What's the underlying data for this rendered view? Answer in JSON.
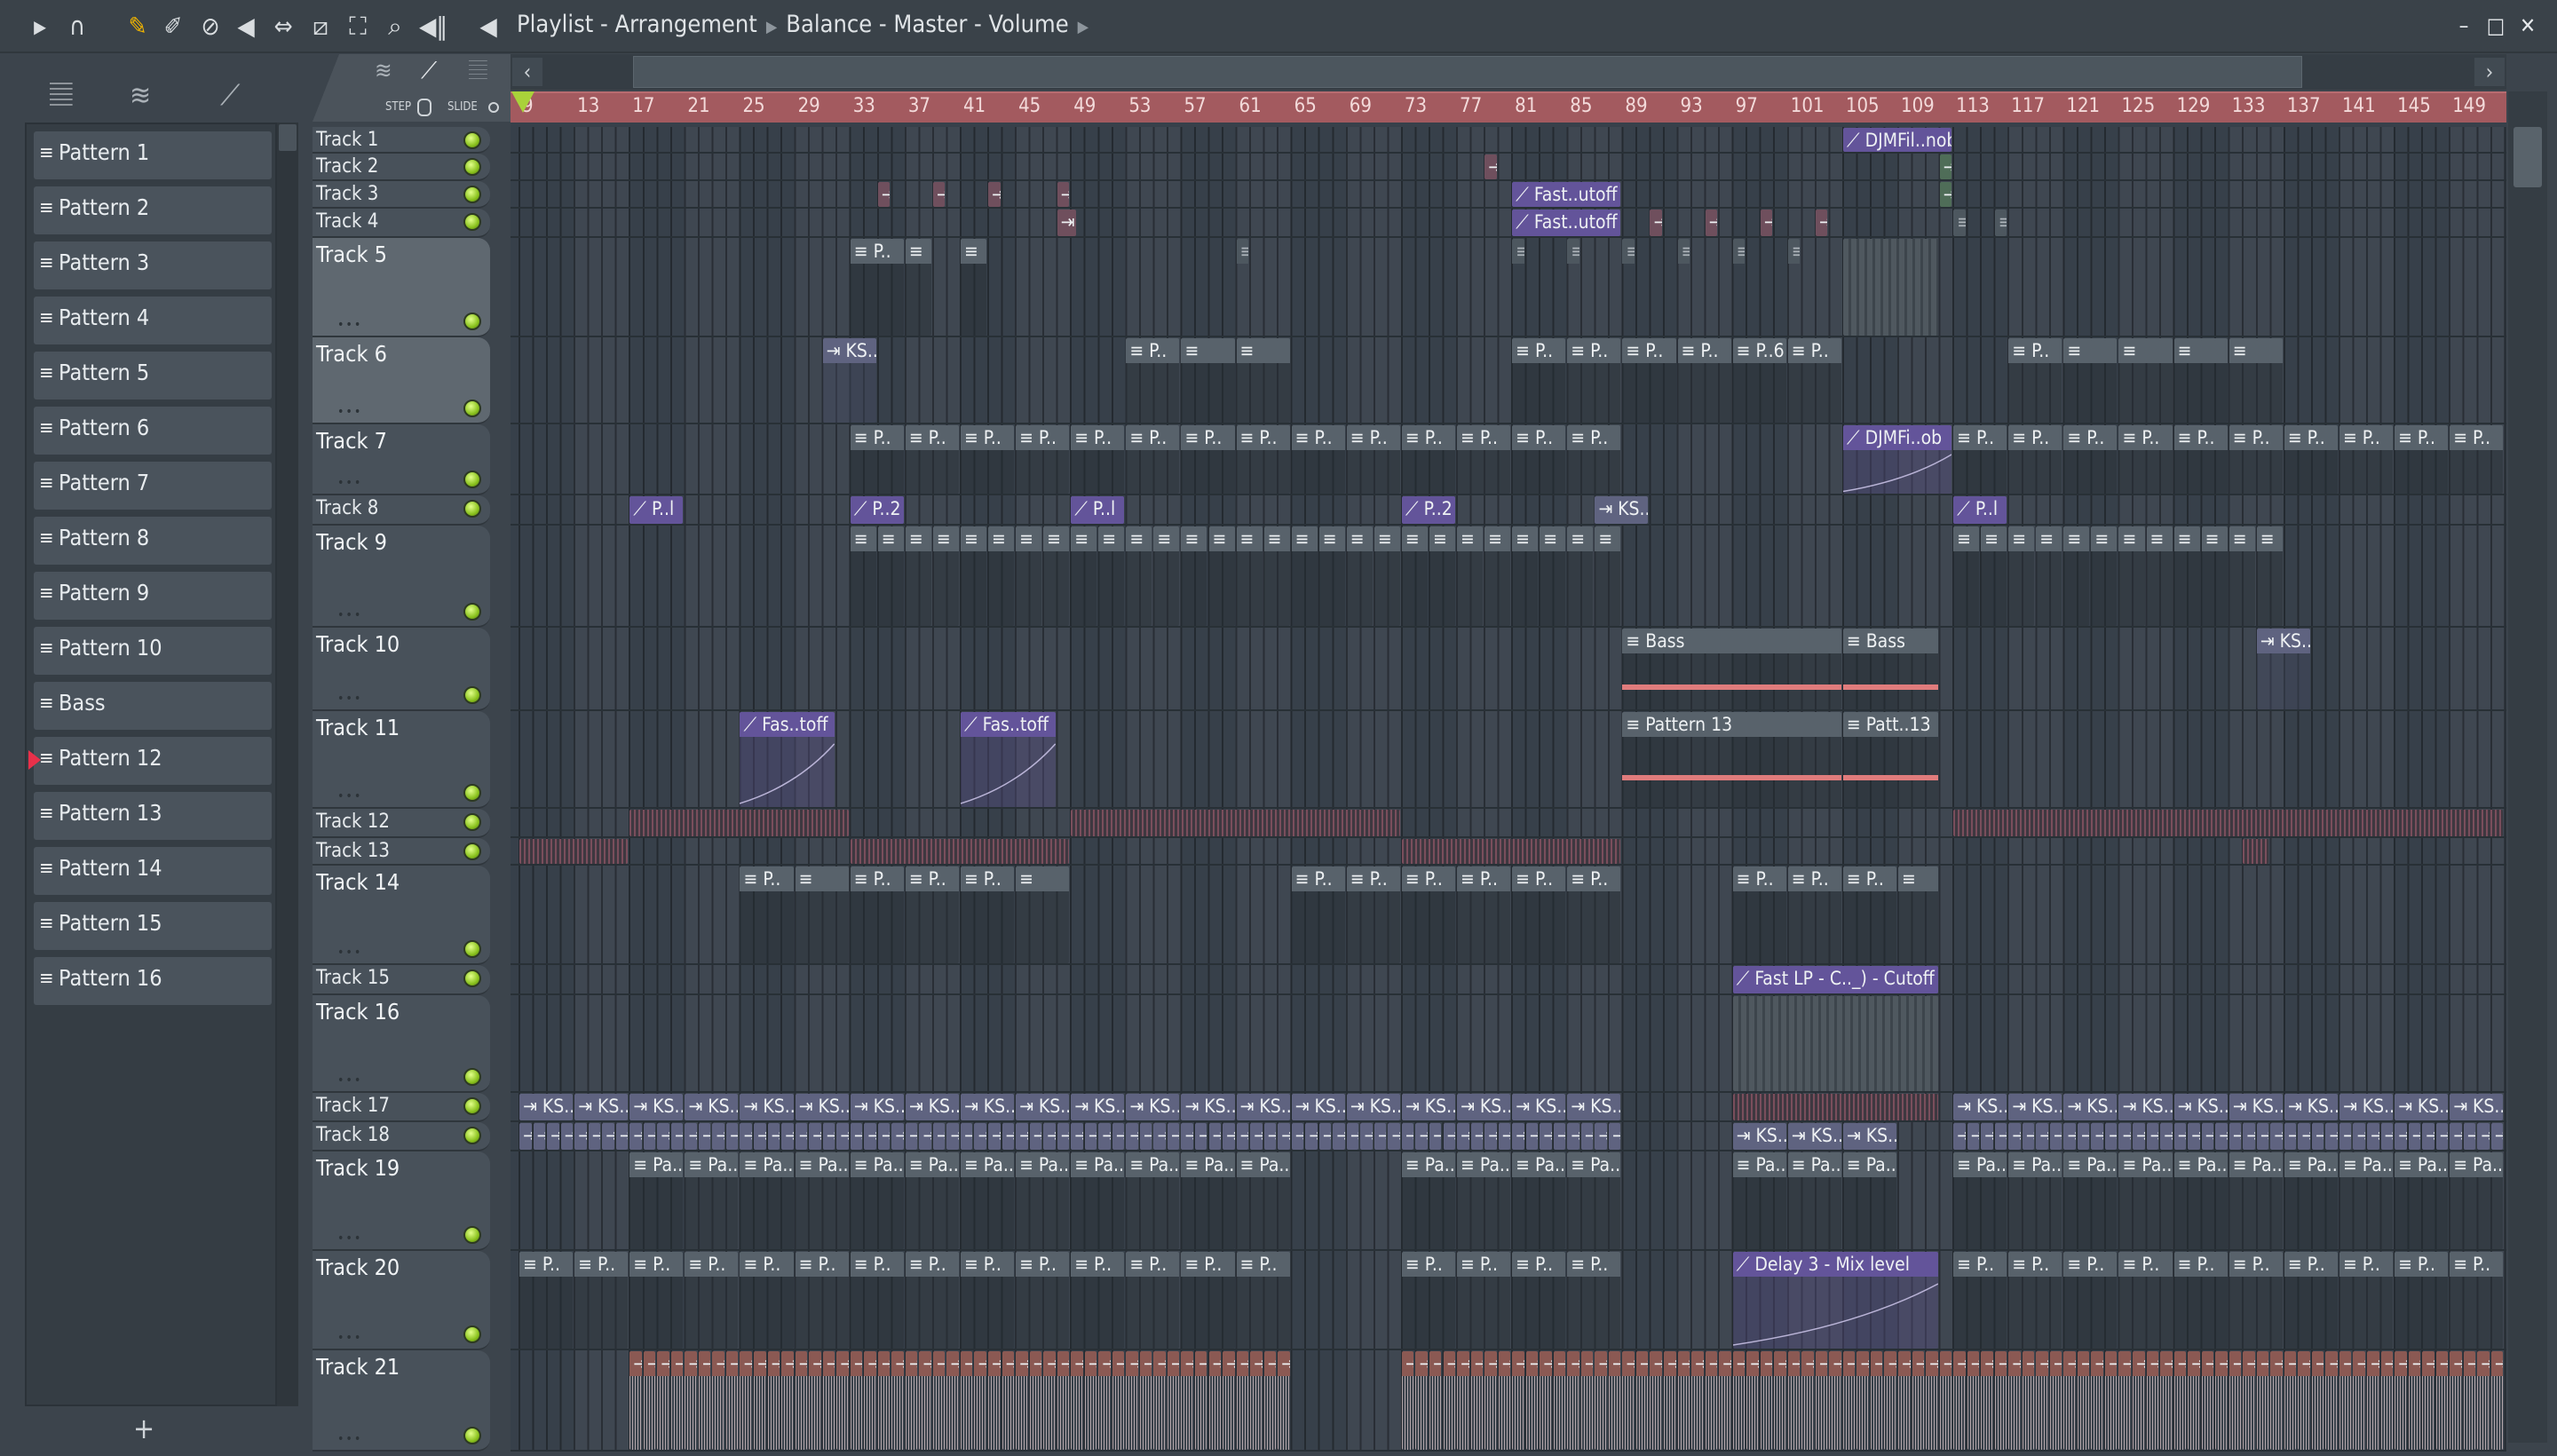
{
  "toolbar": {
    "icons": [
      "play-arrow",
      "magnet",
      "pencil",
      "paint",
      "delete",
      "mute",
      "slip",
      "slice",
      "select",
      "zoom",
      "playback"
    ],
    "title": "Playlist - Arrangement",
    "breadcrumb": "Balance - Master - Volume"
  },
  "window_controls": {
    "minimize": "–",
    "maximize": "□",
    "close": "✕"
  },
  "tool_tab": {
    "step_label": "STEP",
    "slide_label": "SLIDE"
  },
  "accent": {
    "ruler": "#a35a5f",
    "playhead": "#a9d23a",
    "led": "#8ac21e",
    "selected_marker": "#e8304a"
  },
  "patterns": [
    {
      "label": "Pattern 1"
    },
    {
      "label": "Pattern 2"
    },
    {
      "label": "Pattern 3"
    },
    {
      "label": "Pattern 4"
    },
    {
      "label": "Pattern 5"
    },
    {
      "label": "Pattern 6"
    },
    {
      "label": "Pattern 7"
    },
    {
      "label": "Pattern 8"
    },
    {
      "label": "Pattern 9"
    },
    {
      "label": "Pattern 10"
    },
    {
      "label": "Bass"
    },
    {
      "label": "Pattern 12",
      "selected": true
    },
    {
      "label": "Pattern 13"
    },
    {
      "label": "Pattern 14"
    },
    {
      "label": "Pattern 15"
    },
    {
      "label": "Pattern 16"
    }
  ],
  "add_pattern": "+",
  "ruler": {
    "bars": [
      9,
      13,
      17,
      21,
      25,
      29,
      33,
      37,
      41,
      45,
      49,
      53,
      57,
      61,
      65,
      69,
      73,
      77,
      81,
      85,
      89,
      93,
      97,
      101,
      105,
      109,
      113,
      117,
      121,
      125,
      129,
      133,
      137,
      141,
      145,
      149
    ]
  },
  "tracks": [
    {
      "label": "Track 1"
    },
    {
      "label": "Track 2"
    },
    {
      "label": "Track 3"
    },
    {
      "label": "Track 4"
    },
    {
      "label": "Track 5",
      "tall": true,
      "highlight": true
    },
    {
      "label": "Track 6",
      "tall": true,
      "highlight": true
    },
    {
      "label": "Track 7",
      "tall": true
    },
    {
      "label": "Track 8"
    },
    {
      "label": "Track 9",
      "tall": true
    },
    {
      "label": "Track 10",
      "tall": true
    },
    {
      "label": "Track 11",
      "tall": true
    },
    {
      "label": "Track 12"
    },
    {
      "label": "Track 13"
    },
    {
      "label": "Track 14",
      "tall": true
    },
    {
      "label": "Track 15"
    },
    {
      "label": "Track 16",
      "tall": true
    },
    {
      "label": "Track 17"
    },
    {
      "label": "Track 18"
    },
    {
      "label": "Track 19",
      "tall": true
    },
    {
      "label": "Track 20",
      "tall": true
    },
    {
      "label": "Track 21",
      "tall": true
    }
  ],
  "clips": [
    {
      "t": 1,
      "s": 105,
      "l": 8,
      "type": "auto",
      "label": "DJMFil..nob"
    },
    {
      "t": 2,
      "s": 79,
      "l": 1,
      "type": "audio-red",
      "label": ""
    },
    {
      "t": 2,
      "s": 112,
      "l": 1,
      "type": "audio-green",
      "label": ""
    },
    {
      "t": 3,
      "s": 35,
      "l": 1,
      "n": 3,
      "step": 4,
      "type": "audio-red",
      "label": ""
    },
    {
      "t": 3,
      "s": 48,
      "l": 1,
      "type": "audio-red",
      "label": ""
    },
    {
      "t": 3,
      "s": 81,
      "l": 8,
      "type": "auto",
      "label": "Fast..utoff"
    },
    {
      "t": 3,
      "s": 112,
      "l": 1,
      "type": "audio-green",
      "label": ""
    },
    {
      "t": 4,
      "s": 48,
      "l": 1.5,
      "type": "audio-red",
      "label": ""
    },
    {
      "t": 4,
      "s": 81,
      "l": 8,
      "type": "auto",
      "label": "Fast..utoff"
    },
    {
      "t": 4,
      "s": 91,
      "l": 1,
      "n": 4,
      "step": 4,
      "type": "audio-red",
      "label": ""
    },
    {
      "t": 4,
      "s": 113,
      "l": 1,
      "n": 2,
      "step": 3,
      "type": "mini",
      "label": ""
    },
    {
      "t": 5,
      "s": 33,
      "l": 4,
      "type": "pattern",
      "label": "P.."
    },
    {
      "t": 5,
      "s": 37,
      "l": 2,
      "type": "pattern",
      "label": ""
    },
    {
      "t": 5,
      "s": 41,
      "l": 2,
      "type": "pattern",
      "label": ""
    },
    {
      "t": 5,
      "s": 61,
      "l": 1,
      "type": "mini",
      "label": ""
    },
    {
      "t": 5,
      "s": 81,
      "l": 1,
      "n": 6,
      "step": 4,
      "type": "mini",
      "label": ""
    },
    {
      "t": 5,
      "s": 105,
      "l": 7,
      "type": "dense",
      "label": ""
    },
    {
      "t": 6,
      "s": 31,
      "l": 4,
      "type": "audio",
      "label": "KS.."
    },
    {
      "t": 6,
      "s": 53,
      "l": 4,
      "type": "pattern",
      "label": "P.."
    },
    {
      "t": 6,
      "s": 57,
      "l": 4,
      "n": 2,
      "step": 4,
      "type": "pattern",
      "label": ""
    },
    {
      "t": 6,
      "s": 81,
      "l": 4,
      "n": 4,
      "step": 4,
      "type": "pattern",
      "label": "P.."
    },
    {
      "t": 6,
      "s": 97,
      "l": 4,
      "type": "pattern",
      "label": "P..6"
    },
    {
      "t": 6,
      "s": 101,
      "l": 4,
      "type": "pattern",
      "label": "P.."
    },
    {
      "t": 6,
      "s": 117,
      "l": 4,
      "type": "pattern",
      "label": "P.."
    },
    {
      "t": 6,
      "s": 121,
      "l": 4,
      "n": 4,
      "step": 4,
      "type": "pattern",
      "label": ""
    },
    {
      "t": 7,
      "s": 33,
      "l": 4,
      "n": 4,
      "step": 4,
      "type": "pattern",
      "label": "P.."
    },
    {
      "t": 7,
      "s": 49,
      "l": 4,
      "n": 10,
      "step": 4,
      "type": "pattern",
      "label": "P.."
    },
    {
      "t": 7,
      "s": 105,
      "l": 8,
      "type": "auto",
      "label": "DJMFi..ob"
    },
    {
      "t": 7,
      "s": 113,
      "l": 4,
      "n": 10,
      "step": 4,
      "type": "pattern",
      "label": "P.."
    },
    {
      "t": 8,
      "s": 17,
      "l": 4,
      "type": "auto",
      "label": "P..l"
    },
    {
      "t": 8,
      "s": 33,
      "l": 4,
      "type": "auto",
      "label": "P..2"
    },
    {
      "t": 8,
      "s": 49,
      "l": 4,
      "type": "auto",
      "label": "P..l"
    },
    {
      "t": 8,
      "s": 73,
      "l": 4,
      "type": "auto",
      "label": "P..2"
    },
    {
      "t": 8,
      "s": 87,
      "l": 4,
      "type": "audio",
      "label": "KS.."
    },
    {
      "t": 8,
      "s": 113,
      "l": 4,
      "type": "auto",
      "label": "P..l"
    },
    {
      "t": 9,
      "s": 33,
      "l": 2,
      "n": 8,
      "step": 2,
      "type": "pattern",
      "label": ""
    },
    {
      "t": 9,
      "s": 49,
      "l": 2,
      "n": 20,
      "step": 2,
      "type": "pattern",
      "label": ""
    },
    {
      "t": 9,
      "s": 113,
      "l": 2,
      "n": 12,
      "step": 2,
      "type": "pattern",
      "label": ""
    },
    {
      "t": 10,
      "s": 89,
      "l": 16,
      "type": "pattern-line",
      "label": "Bass"
    },
    {
      "t": 10,
      "s": 105,
      "l": 7,
      "type": "pattern-line",
      "label": "Bass"
    },
    {
      "t": 10,
      "s": 135,
      "l": 4,
      "type": "audio",
      "label": "KS.."
    },
    {
      "t": 11,
      "s": 25,
      "l": 7,
      "type": "auto",
      "label": "Fas..toff"
    },
    {
      "t": 11,
      "s": 41,
      "l": 7,
      "type": "auto",
      "label": "Fas..toff"
    },
    {
      "t": 11,
      "s": 89,
      "l": 16,
      "type": "pattern-line",
      "label": "Pattern 13"
    },
    {
      "t": 11,
      "s": 105,
      "l": 7,
      "type": "pattern-line",
      "label": "Patt..13"
    },
    {
      "t": 12,
      "s": 17,
      "l": 16,
      "type": "strip",
      "label": ""
    },
    {
      "t": 12,
      "s": 49,
      "l": 24,
      "type": "strip",
      "label": ""
    },
    {
      "t": 12,
      "s": 113,
      "l": 40,
      "type": "strip",
      "label": ""
    },
    {
      "t": 13,
      "s": 9,
      "l": 8,
      "type": "strip",
      "label": ""
    },
    {
      "t": 13,
      "s": 33,
      "l": 16,
      "type": "strip",
      "label": ""
    },
    {
      "t": 13,
      "s": 73,
      "l": 16,
      "type": "strip",
      "label": ""
    },
    {
      "t": 13,
      "s": 134,
      "l": 2,
      "type": "strip",
      "label": ""
    },
    {
      "t": 14,
      "s": 25,
      "l": 4,
      "type": "pattern",
      "label": "P.."
    },
    {
      "t": 14,
      "s": 29,
      "l": 4,
      "type": "pattern",
      "label": ""
    },
    {
      "t": 14,
      "s": 33,
      "l": 4,
      "n": 3,
      "step": 4,
      "type": "pattern",
      "label": "P.."
    },
    {
      "t": 14,
      "s": 45,
      "l": 4,
      "type": "pattern",
      "label": ""
    },
    {
      "t": 14,
      "s": 65,
      "l": 4,
      "n": 6,
      "step": 4,
      "type": "pattern",
      "label": "P.."
    },
    {
      "t": 14,
      "s": 97,
      "l": 4,
      "n": 3,
      "step": 4,
      "type": "pattern",
      "label": "P.."
    },
    {
      "t": 14,
      "s": 109,
      "l": 3,
      "type": "pattern",
      "label": ""
    },
    {
      "t": 15,
      "s": 97,
      "l": 15,
      "type": "auto",
      "label": "Fast LP - C.._) - Cutoff"
    },
    {
      "t": 16,
      "s": 97,
      "l": 15,
      "type": "dense",
      "label": ""
    },
    {
      "t": 17,
      "s": 9,
      "l": 4,
      "n": 10,
      "step": 4,
      "type": "audio",
      "label": "KS.."
    },
    {
      "t": 17,
      "s": 49,
      "l": 4,
      "n": 10,
      "step": 4,
      "type": "audio",
      "label": "KS.."
    },
    {
      "t": 17,
      "s": 97,
      "l": 15,
      "type": "strip",
      "label": ""
    },
    {
      "t": 17,
      "s": 113,
      "l": 4,
      "n": 10,
      "step": 4,
      "type": "audio",
      "label": "KS.."
    },
    {
      "t": 18,
      "s": 9,
      "l": 1,
      "n": 40,
      "step": 1,
      "type": "audio",
      "label": ""
    },
    {
      "t": 18,
      "s": 49,
      "l": 1,
      "n": 40,
      "step": 1,
      "type": "audio",
      "label": ""
    },
    {
      "t": 18,
      "s": 97,
      "l": 4,
      "n": 3,
      "step": 4,
      "type": "audio",
      "label": "KS.."
    },
    {
      "t": 18,
      "s": 113,
      "l": 1,
      "n": 40,
      "step": 1,
      "type": "audio",
      "label": ""
    },
    {
      "t": 19,
      "s": 17,
      "l": 4,
      "n": 8,
      "step": 4,
      "type": "pattern",
      "label": "Pa.."
    },
    {
      "t": 19,
      "s": 49,
      "l": 4,
      "n": 4,
      "step": 4,
      "type": "pattern",
      "label": "Pa.."
    },
    {
      "t": 19,
      "s": 73,
      "l": 4,
      "n": 4,
      "step": 4,
      "type": "pattern",
      "label": "Pa.."
    },
    {
      "t": 19,
      "s": 97,
      "l": 4,
      "n": 3,
      "step": 4,
      "type": "pattern",
      "label": "Pa.."
    },
    {
      "t": 19,
      "s": 113,
      "l": 4,
      "n": 10,
      "step": 4,
      "type": "pattern",
      "label": "Pa.."
    },
    {
      "t": 20,
      "s": 9,
      "l": 4,
      "n": 10,
      "step": 4,
      "type": "pattern",
      "label": "P.."
    },
    {
      "t": 20,
      "s": 49,
      "l": 4,
      "n": 4,
      "step": 4,
      "type": "pattern",
      "label": "P.."
    },
    {
      "t": 20,
      "s": 73,
      "l": 4,
      "n": 4,
      "step": 4,
      "type": "pattern",
      "label": "P.."
    },
    {
      "t": 20,
      "s": 97,
      "l": 15,
      "type": "auto",
      "label": "Delay 3 - Mix level"
    },
    {
      "t": 20,
      "s": 113,
      "l": 4,
      "n": 10,
      "step": 4,
      "type": "pattern",
      "label": "P.."
    },
    {
      "t": 21,
      "s": 17,
      "l": 1,
      "n": 48,
      "step": 1,
      "type": "orange",
      "label": ""
    },
    {
      "t": 21,
      "s": 73,
      "l": 1,
      "n": 80,
      "step": 1,
      "type": "orange",
      "label": ""
    }
  ]
}
